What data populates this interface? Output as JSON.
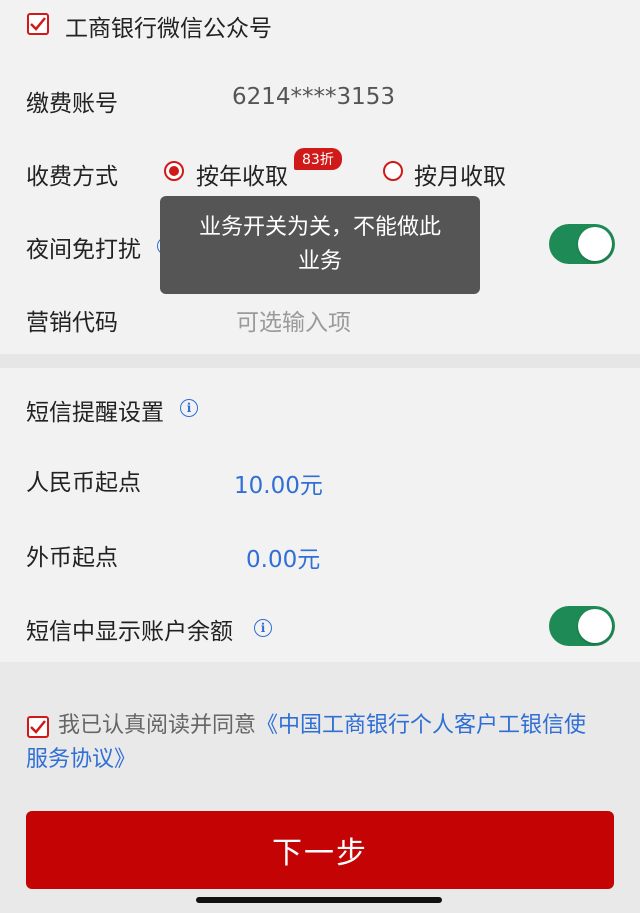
{
  "top_option": {
    "label": "工商银行微信公众号",
    "checked": true
  },
  "account": {
    "label": "缴费账号",
    "value": "6214****3153"
  },
  "fee_method": {
    "label": "收费方式",
    "options": [
      {
        "label": "按年收取",
        "selected": true,
        "badge": "83折"
      },
      {
        "label": "按月收取",
        "selected": false
      }
    ]
  },
  "night_dnd": {
    "label": "夜间免打扰",
    "on": true
  },
  "tooltip": {
    "line1": "业务开关为关，不能做此",
    "line2": "业务"
  },
  "marketing": {
    "label": "营销代码",
    "placeholder": "可选输入项"
  },
  "sms": {
    "title": "短信提醒设置",
    "rmb": {
      "label": "人民币起点",
      "value": "10.00元"
    },
    "fx": {
      "label": "外币起点",
      "value": "0.00元"
    },
    "show_balance": {
      "label": "短信中显示账户余额",
      "on": true
    }
  },
  "agreement": {
    "checked": true,
    "prefix": "我已认真阅读并同意",
    "link_line1": "《中国工商银行个人客户工银信使",
    "link_line2": "服务协议》"
  },
  "next_button": {
    "label": "下一步"
  },
  "colors": {
    "brand_red": "#c40404",
    "toggle_green": "#1e8a55",
    "link_blue": "#2f6fd6"
  }
}
